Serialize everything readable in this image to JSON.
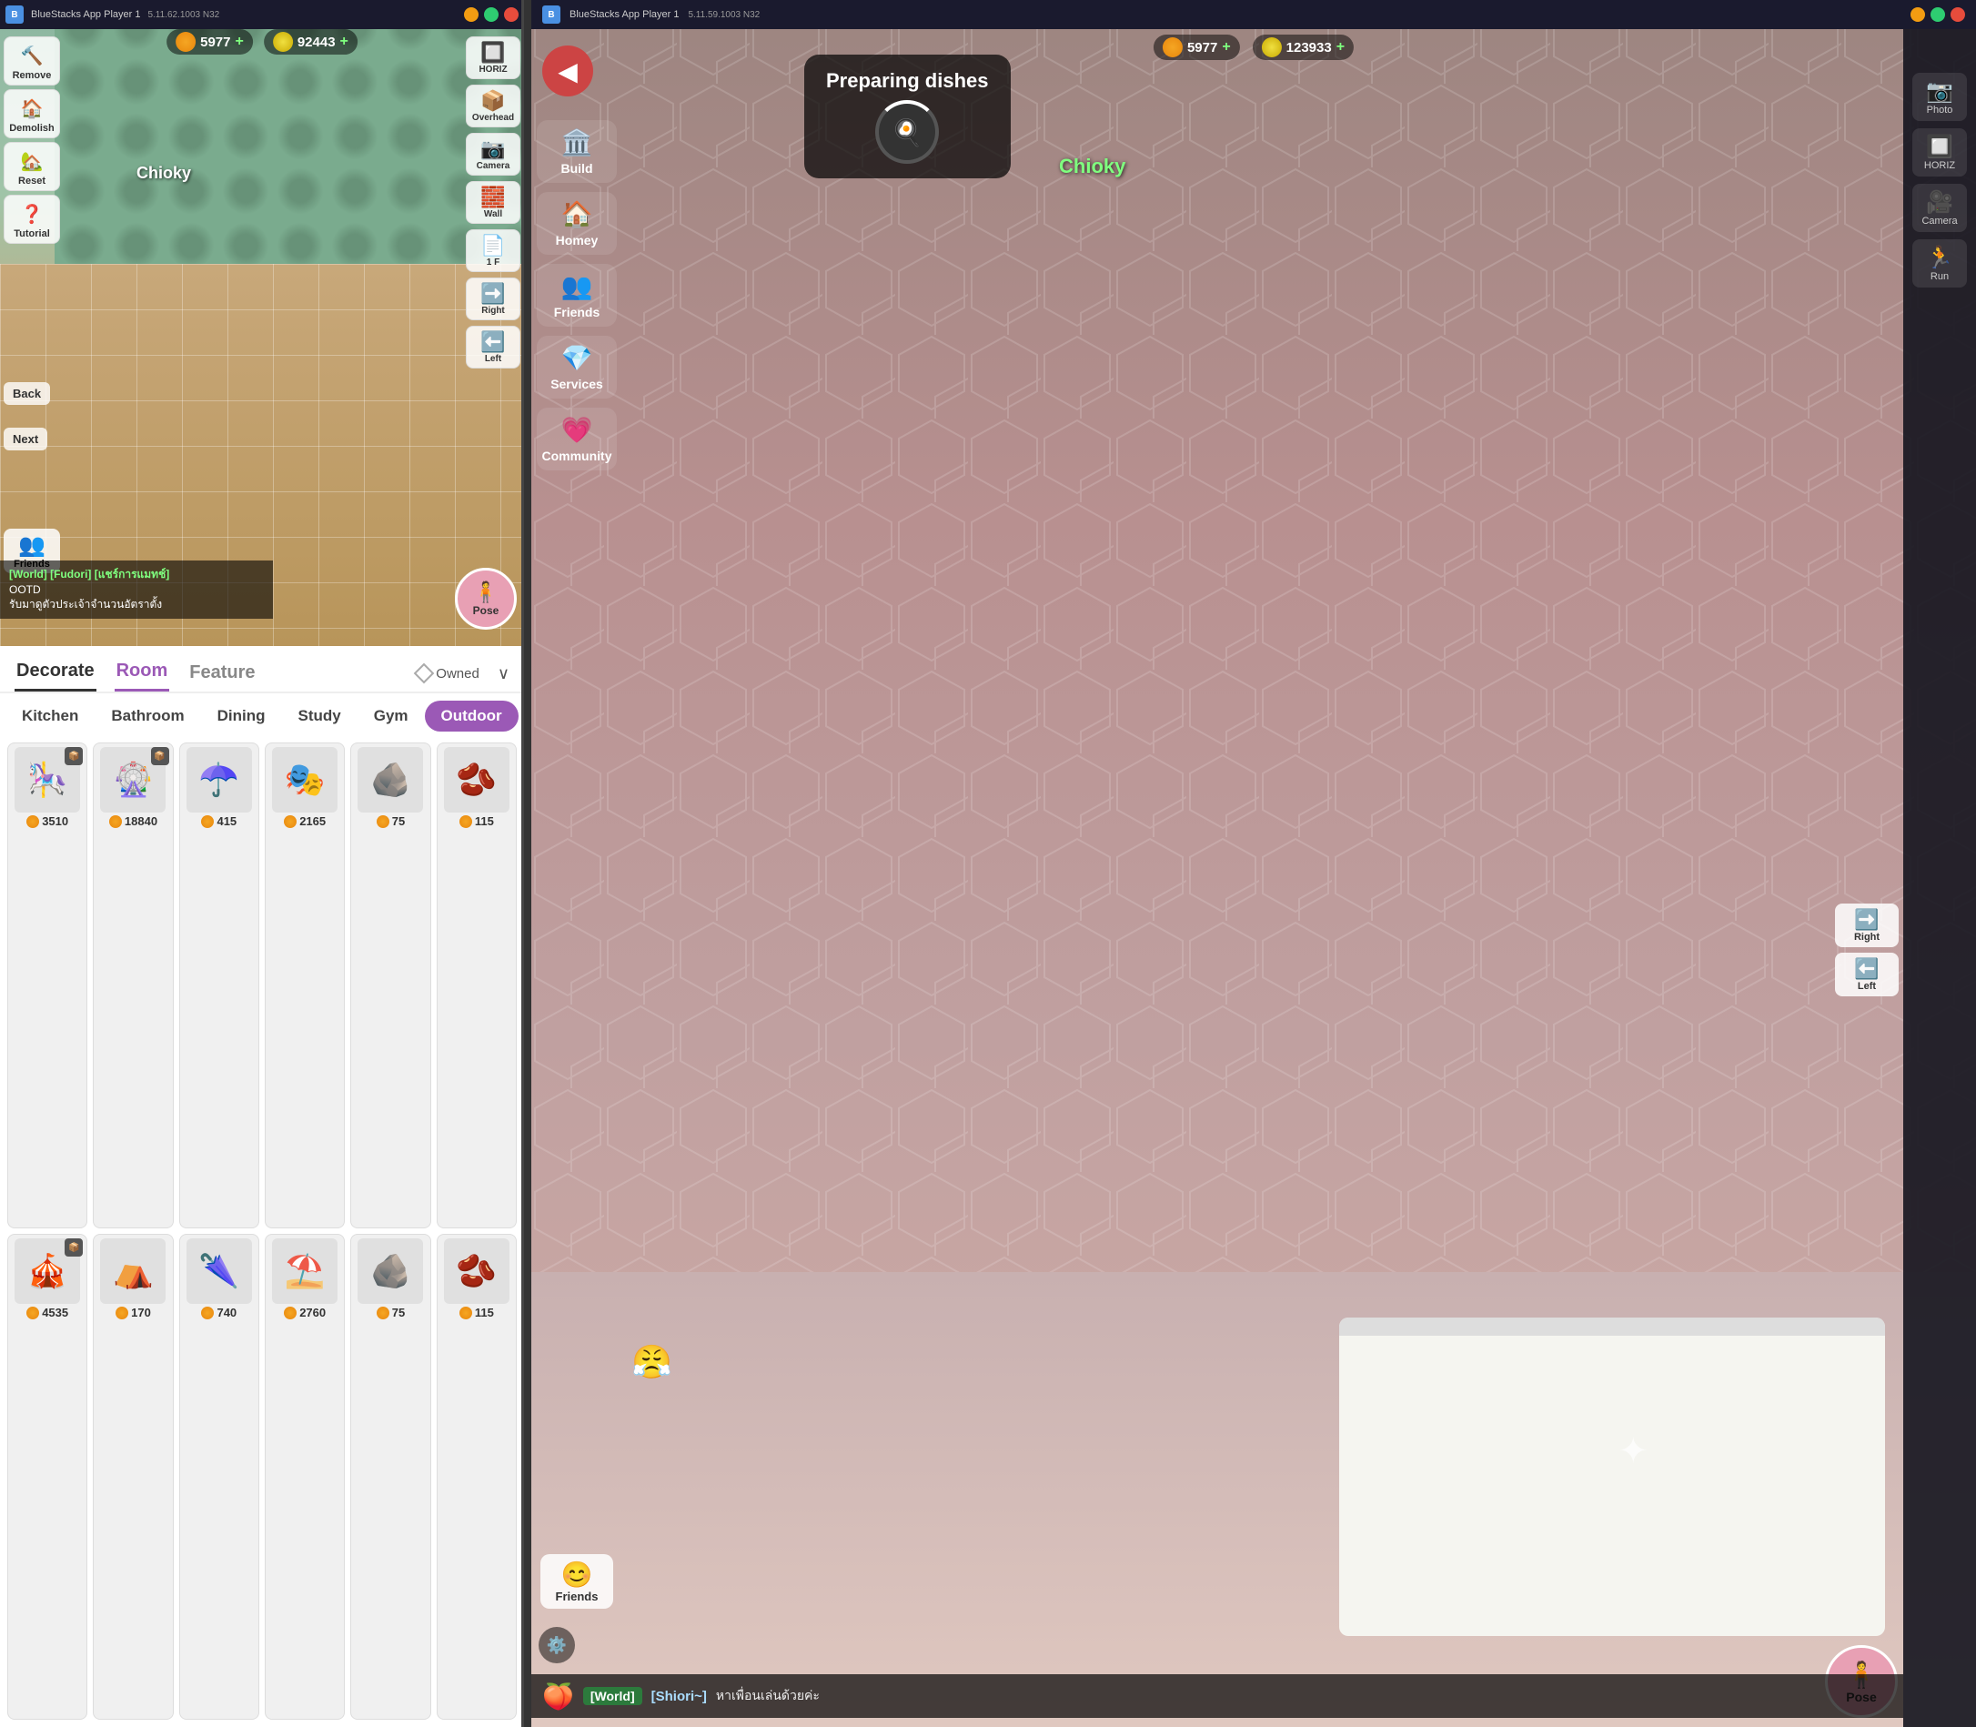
{
  "left": {
    "bluestacks": {
      "title": "BlueStacks App Player 1",
      "version": "5.11.62.1003  N32"
    },
    "currency": {
      "gems": "5977",
      "coins": "92443"
    },
    "toolbar": {
      "remove": "Remove",
      "demolish": "Demolish",
      "reset": "Reset",
      "tutorial": "Tutorial",
      "back": "Back",
      "next": "Next",
      "friends": "Friends"
    },
    "view_controls": {
      "horiz": "HORIZ",
      "overhead": "Overhead",
      "camera": "Camera",
      "wall": "Wall",
      "floor": "1 F",
      "right": "Right",
      "left": "Left"
    },
    "character": {
      "name": "Chioky"
    },
    "chat": {
      "tags": "[World] [Fudori] [แชร์การแมทช์]",
      "line": "OOTD",
      "message": "รับมาดูตัวประเจ้าจำนวนอัตราตั้ง",
      "pose": "Pose"
    },
    "bottom": {
      "tabs": [
        {
          "id": "decorate",
          "label": "Decorate",
          "active": false
        },
        {
          "id": "room",
          "label": "Room",
          "active": true
        },
        {
          "id": "feature",
          "label": "Feature",
          "active": false
        }
      ],
      "owned": "Owned",
      "categories": [
        {
          "id": "kitchen",
          "label": "Kitchen",
          "active": false
        },
        {
          "id": "bathroom",
          "label": "Bathroom",
          "active": false
        },
        {
          "id": "dining",
          "label": "Dining",
          "active": false
        },
        {
          "id": "study",
          "label": "Study",
          "active": false
        },
        {
          "id": "gym",
          "label": "Gym",
          "active": false
        },
        {
          "id": "outdoor",
          "label": "Outdoor",
          "active": true
        }
      ],
      "items": [
        {
          "emoji": "🎠",
          "price": "3510",
          "badge": "📦"
        },
        {
          "emoji": "🎡",
          "price": "18840",
          "badge": "📦"
        },
        {
          "emoji": "☂️",
          "price": "415",
          "badge": ""
        },
        {
          "emoji": "🎭",
          "price": "2165",
          "badge": ""
        },
        {
          "emoji": "🪨",
          "price": "75",
          "badge": ""
        },
        {
          "emoji": "🫘",
          "price": "115",
          "badge": ""
        },
        {
          "emoji": "🎪",
          "price": "4535",
          "badge": "📦"
        },
        {
          "emoji": "⛺",
          "price": "170",
          "badge": ""
        },
        {
          "emoji": "🌂",
          "price": "740",
          "badge": ""
        },
        {
          "emoji": "⛱️",
          "price": "2760",
          "badge": ""
        },
        {
          "emoji": "🪨",
          "price": "75",
          "badge": ""
        },
        {
          "emoji": "🫘",
          "price": "115",
          "badge": ""
        }
      ]
    }
  },
  "right": {
    "bluestacks": {
      "title": "BlueStacks App Player 1",
      "version": "5.11.59.1003  N32"
    },
    "currency": {
      "gems": "5977",
      "coins": "123933"
    },
    "menu": {
      "build": "Build",
      "homey": "Homey",
      "friends": "Friends",
      "services": "Services",
      "community": "Community"
    },
    "view_controls": {
      "photo": "Photo",
      "horiz": "HORIZ",
      "camera": "Camera",
      "run": "Run",
      "right": "Right",
      "left": "Left"
    },
    "character": {
      "name": "Chioky",
      "activity": "Preparing dishes"
    },
    "chat": {
      "world_tag": "[World]",
      "user": "[Shiori~]",
      "message": "หาเพื่อนเล่นด้วยค่ะ",
      "pose": "Pose"
    },
    "friends_label": "Friends"
  }
}
